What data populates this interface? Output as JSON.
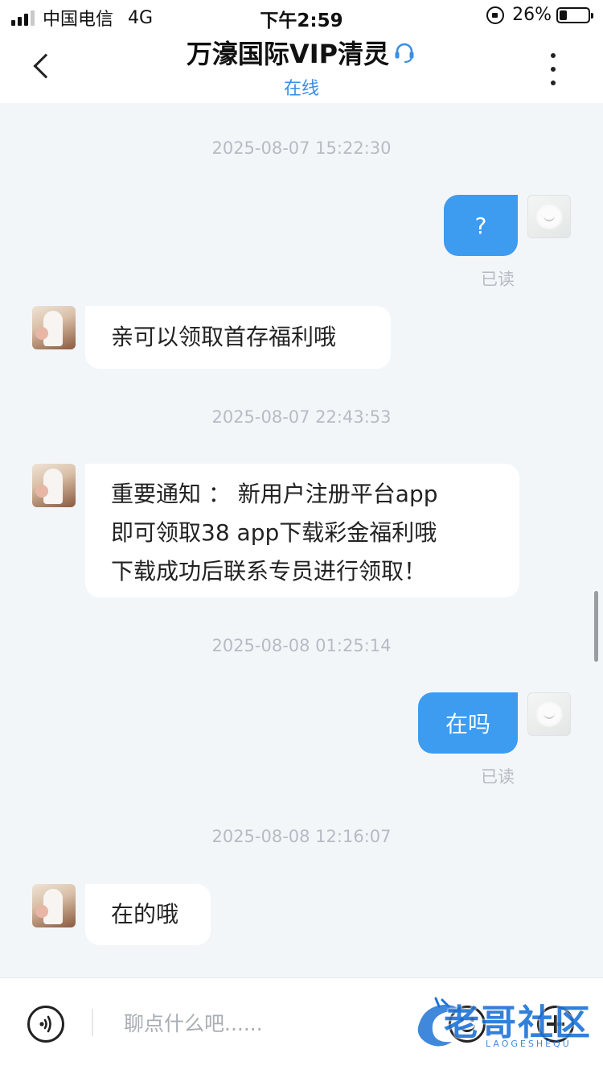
{
  "status_bar": {
    "carrier": "中国电信",
    "network": "4G",
    "time": "下午2:59",
    "battery_percent": "26%",
    "battery_level": 0.26
  },
  "header": {
    "title": "万濠国际VIP清灵",
    "status": "在线"
  },
  "messages": [
    {
      "type": "timestamp",
      "text": "2025-08-07 15:22:30"
    },
    {
      "type": "outgoing",
      "text": "?",
      "receipt": "已读"
    },
    {
      "type": "incoming",
      "text": "亲可以领取首存福利哦"
    },
    {
      "type": "timestamp",
      "text": "2025-08-07 22:43:53"
    },
    {
      "type": "incoming",
      "lines": [
        "重要通知 ： 新用户注册平台app",
        "即可领取38 app下载彩金福利哦",
        "下载成功后联系专员进行领取！"
      ]
    },
    {
      "type": "timestamp",
      "text": "2025-08-08 01:25:14"
    },
    {
      "type": "outgoing",
      "text": "在吗",
      "receipt": "已读"
    },
    {
      "type": "timestamp",
      "text": "2025-08-08 12:16:07"
    },
    {
      "type": "incoming",
      "text": "在的哦"
    }
  ],
  "input_bar": {
    "placeholder": "聊点什么吧......"
  },
  "watermark": {
    "text": "老哥社区",
    "subtext": "LAOGESHEQU"
  },
  "colors": {
    "accent_blue": "#3d9bf0",
    "online_blue": "#3a8ee6",
    "background": "#f3f6f9"
  }
}
